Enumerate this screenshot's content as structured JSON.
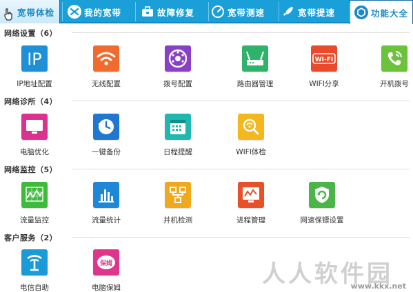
{
  "tabs": [
    {
      "label": "宽带体检",
      "icon": "pointer-icon"
    },
    {
      "label": "我的宽带",
      "icon": "globe-icon"
    },
    {
      "label": "故障修复",
      "icon": "toolbox-icon"
    },
    {
      "label": "宽带测速",
      "icon": "speedometer-icon"
    },
    {
      "label": "宽带提速",
      "icon": "rocket-icon"
    },
    {
      "label": "功能大全",
      "icon": "grid-icon"
    }
  ],
  "sections": [
    {
      "title": "网络设置（6）",
      "items": [
        {
          "label": "IP地址配置",
          "icon": "ip-icon",
          "color": "#1f8fd6"
        },
        {
          "label": "无线配置",
          "icon": "wifi-icon",
          "color": "#f26b2e"
        },
        {
          "label": "拨号配置",
          "icon": "dial-phone-icon",
          "color": "#8a3fc7"
        },
        {
          "label": "路由器管理",
          "icon": "router-icon",
          "color": "#2fb36a"
        },
        {
          "label": "WIFI分享",
          "icon": "wifi-share-icon",
          "color": "#e84a2b"
        },
        {
          "label": "开机拨号",
          "icon": "phone-call-icon",
          "color": "#6cc23a"
        }
      ]
    },
    {
      "title": "网络诊所（4）",
      "items": [
        {
          "label": "电脑优化",
          "icon": "monitor-icon",
          "color": "#d9328f"
        },
        {
          "label": "一键备份",
          "icon": "backup-clock-icon",
          "color": "#1f77cf"
        },
        {
          "label": "日程提醒",
          "icon": "calendar-icon",
          "color": "#1fb7b0"
        },
        {
          "label": "WIFI体检",
          "icon": "wifi-check-icon",
          "color": "#f2b81d"
        }
      ]
    },
    {
      "title": "网络监控（5）",
      "items": [
        {
          "label": "流量监控",
          "icon": "traffic-monitor-icon",
          "color": "#3ebb3a"
        },
        {
          "label": "流量统计",
          "icon": "bar-stats-icon",
          "color": "#1f88d6"
        },
        {
          "label": "并机检测",
          "icon": "network-topology-icon",
          "color": "#f0a81c"
        },
        {
          "label": "进程管理",
          "icon": "process-monitor-icon",
          "color": "#e6512a"
        },
        {
          "label": "网速保镖设置",
          "icon": "shield-refresh-icon",
          "color": "#4bb548"
        }
      ]
    },
    {
      "title": "客户服务（2）",
      "items": [
        {
          "label": "电信自助",
          "icon": "telecom-logo-icon",
          "color": "#1a9ad6"
        },
        {
          "label": "电脑保姆",
          "icon": "nanny-icon",
          "color": "#e0358d",
          "badge": "保姆"
        }
      ]
    }
  ],
  "watermark": {
    "text": "人人软件园",
    "url": "www.kkx.net"
  }
}
